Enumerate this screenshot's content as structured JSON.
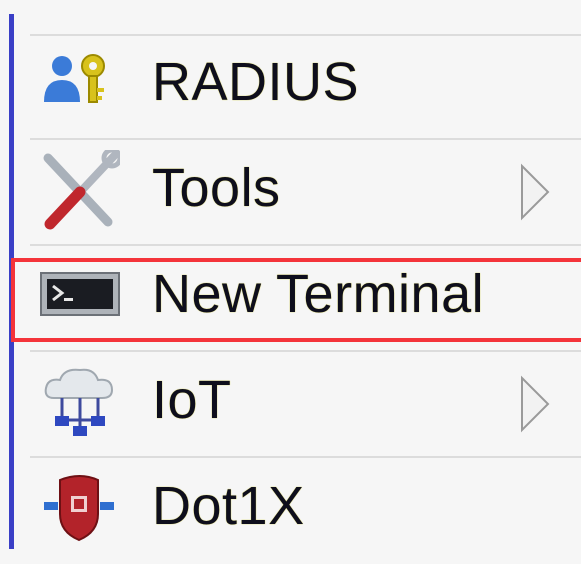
{
  "menu": {
    "items": [
      {
        "label": "RADIUS",
        "icon": "radius-user-key-icon",
        "has_submenu": false
      },
      {
        "label": "Tools",
        "icon": "tools-wrench-screwdriver-icon",
        "has_submenu": true
      },
      {
        "label": "New Terminal",
        "icon": "terminal-icon",
        "has_submenu": false,
        "highlighted": true
      },
      {
        "label": "IoT",
        "icon": "iot-cloud-network-icon",
        "has_submenu": true
      },
      {
        "label": "Dot1X",
        "icon": "dot1x-shield-icon",
        "has_submenu": false
      }
    ]
  },
  "colors": {
    "accent_bar": "#3a3fc6",
    "highlight_border": "#f4343a",
    "background": "#f6f6f6"
  }
}
